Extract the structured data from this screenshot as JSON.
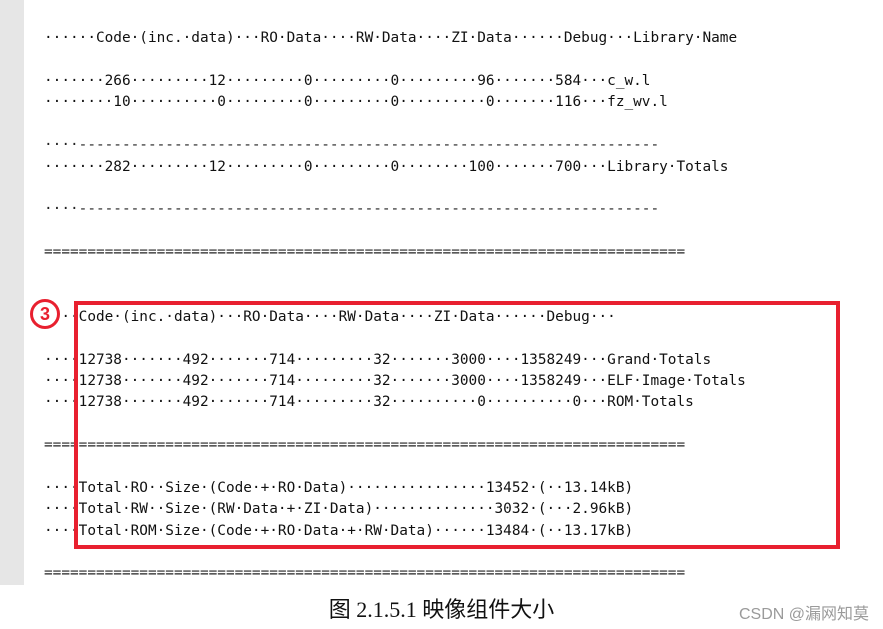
{
  "listing": {
    "header1": "······Code·(inc.·data)···RO·Data····RW·Data····ZI·Data······Debug···Library·Name",
    "row1": "·······266·········12·········0·········0·········96·······584···c_w.l",
    "row2": "········10··········0·········0·········0··········0·······116···fz_wv.l",
    "dash1": "····-------------------------------------------------------------------",
    "totals": "·······282·········12·········0·········0········100·······700···Library·Totals",
    "dash2": "····-------------------------------------------------------------------",
    "eq1": "==========================================================================",
    "header2": "····Code·(inc.·data)···RO·Data····RW·Data····ZI·Data······Debug···",
    "grand": "····12738·······492·······714·········32·······3000····1358249···Grand·Totals",
    "elf": "····12738·······492·······714·········32·······3000····1358249···ELF·Image·Totals",
    "rom": "····12738·······492·······714·········32··········0··········0···ROM·Totals",
    "eq2": "==========================================================================",
    "ro_size": "····Total·RO··Size·(Code·+·RO·Data)················13452·(··13.14kB)",
    "rw_size": "····Total·RW··Size·(RW·Data·+·ZI·Data)··············3032·(···2.96kB)",
    "rom_size": "····Total·ROM·Size·(Code·+·RO·Data·+·RW·Data)······13484·(··13.17kB)",
    "eq3": "=========================================================================="
  },
  "badge": "3",
  "caption": "图 2.1.5.1 映像组件大小",
  "watermark": "CSDN @漏网知莫",
  "colors": {
    "highlight": "#e8202f",
    "gutter": "#e6e6e6"
  }
}
